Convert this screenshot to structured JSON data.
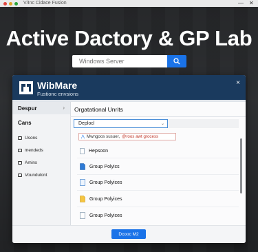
{
  "window": {
    "title": "V/Inc Cidace Fusion"
  },
  "hero": {
    "headline": "Active Dactory & GP Lab",
    "search_placeholder": "Windows Server"
  },
  "dialog": {
    "brand_name": "WibMare",
    "brand_sub": "Fustionc envsions",
    "close_label": "×",
    "sidebar": {
      "header": "Despur",
      "category": "Cans",
      "items": [
        {
          "label": "Usons"
        },
        {
          "label": "mendeds"
        },
        {
          "label": "Amins"
        },
        {
          "label": "Voundulont"
        }
      ]
    },
    "main": {
      "title": "Orgatational Unrits",
      "dropdown_value": "Deplocl",
      "suggestion": {
        "part1": "Mwngoos susuer,",
        "part2": "@roos awt grocess"
      },
      "rows": [
        {
          "label": "Hepsoon",
          "icon": "doc-outline"
        },
        {
          "label": "Group Polyics",
          "icon": "doc-blue"
        },
        {
          "label": "Group Polyices",
          "icon": "doc-outline-blue"
        },
        {
          "label": "Group Polyices",
          "icon": "folder-yellow"
        },
        {
          "label": "Group Polyices",
          "icon": "doc-outline"
        }
      ]
    },
    "ok_label": "Dcooc M2"
  },
  "colors": {
    "accent": "#1a73e8",
    "header": "#1a3a5e"
  }
}
